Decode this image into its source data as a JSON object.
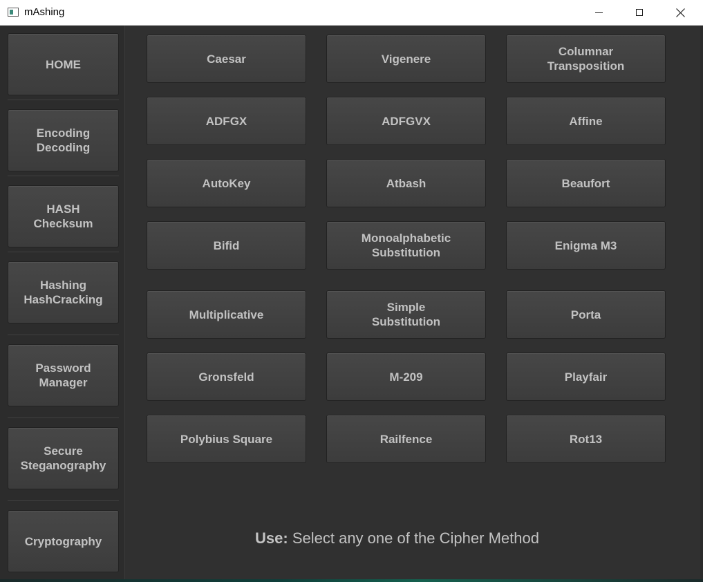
{
  "window": {
    "title": "mAshing"
  },
  "sidebar": {
    "items": [
      {
        "label": "HOME"
      },
      {
        "label": "Encoding\nDecoding"
      },
      {
        "label": "HASH\nChecksum"
      },
      {
        "label": "Hashing\nHashCracking"
      },
      {
        "label": "Password\nManager"
      },
      {
        "label": "Secure\nSteganography"
      },
      {
        "label": "Cryptography"
      }
    ]
  },
  "ciphers": [
    {
      "label": "Caesar"
    },
    {
      "label": "Vigenere"
    },
    {
      "label": "Columnar\nTransposition"
    },
    {
      "label": "ADFGX"
    },
    {
      "label": "ADFGVX"
    },
    {
      "label": "Affine"
    },
    {
      "label": "AutoKey"
    },
    {
      "label": "Atbash"
    },
    {
      "label": "Beaufort"
    },
    {
      "label": "Bifid"
    },
    {
      "label": "Monoalphabetic\nSubstitution"
    },
    {
      "label": "Enigma M3"
    },
    {
      "label": "Multiplicative"
    },
    {
      "label": "Simple\nSubstitution"
    },
    {
      "label": "Porta"
    },
    {
      "label": "Gronsfeld"
    },
    {
      "label": "M-209"
    },
    {
      "label": "Playfair"
    },
    {
      "label": "Polybius Square"
    },
    {
      "label": "Railfence"
    },
    {
      "label": "Rot13"
    }
  ],
  "hint": {
    "label": "Use:",
    "text": " Select any one of the Cipher Method"
  },
  "colors": {
    "background": "#303030",
    "button": "#444444",
    "text": "#c2c2c2"
  },
  "icons": {
    "minimize": "minimize-icon",
    "maximize": "maximize-icon",
    "close": "close-icon"
  }
}
